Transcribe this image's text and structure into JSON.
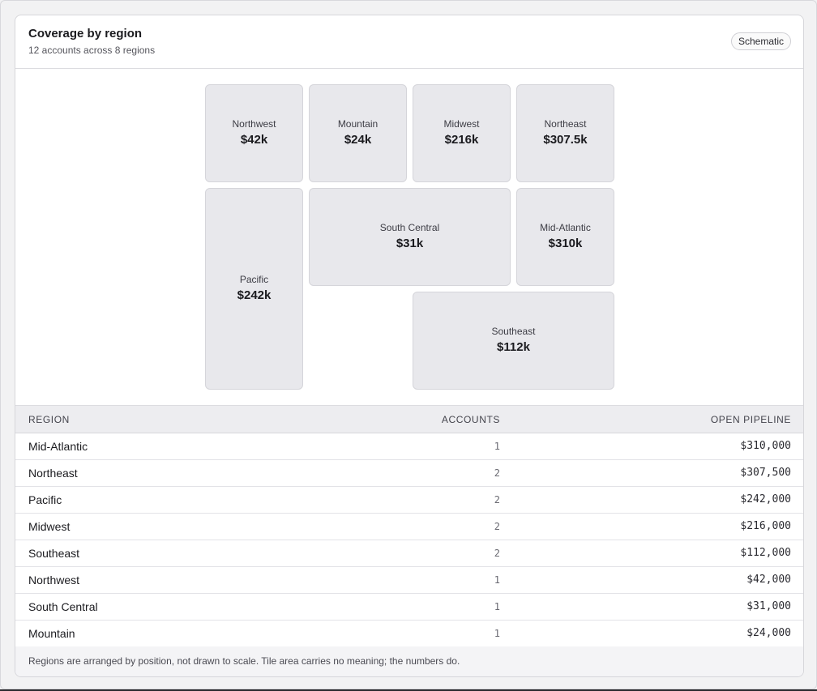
{
  "card": {
    "title": "Coverage by region",
    "subtitle": "12 accounts across 8 regions",
    "badge": "Schematic"
  },
  "tiles": [
    {
      "name": "Northwest",
      "value": "$42k"
    },
    {
      "name": "Mountain",
      "value": "$24k"
    },
    {
      "name": "Midwest",
      "value": "$216k"
    },
    {
      "name": "Northeast",
      "value": "$307.5k"
    },
    {
      "name": "Pacific",
      "value": "$242k"
    },
    {
      "name": "South Central",
      "value": "$31k"
    },
    {
      "name": "Mid-Atlantic",
      "value": "$310k"
    },
    {
      "name": "Southeast",
      "value": "$112k"
    }
  ],
  "table": {
    "headers": [
      "REGION",
      "ACCOUNTS",
      "OPEN PIPELINE"
    ],
    "rows": [
      {
        "region": "Mid-Atlantic",
        "accounts": "1",
        "pipeline": "$310,000"
      },
      {
        "region": "Northeast",
        "accounts": "2",
        "pipeline": "$307,500"
      },
      {
        "region": "Pacific",
        "accounts": "2",
        "pipeline": "$242,000"
      },
      {
        "region": "Midwest",
        "accounts": "2",
        "pipeline": "$216,000"
      },
      {
        "region": "Southeast",
        "accounts": "2",
        "pipeline": "$112,000"
      },
      {
        "region": "Northwest",
        "accounts": "1",
        "pipeline": "$42,000"
      },
      {
        "region": "South Central",
        "accounts": "1",
        "pipeline": "$31,000"
      },
      {
        "region": "Mountain",
        "accounts": "1",
        "pipeline": "$24,000"
      }
    ]
  },
  "footer": {
    "note": "Regions are arranged by position, not drawn to scale. Tile area carries no meaning; the numbers do."
  }
}
